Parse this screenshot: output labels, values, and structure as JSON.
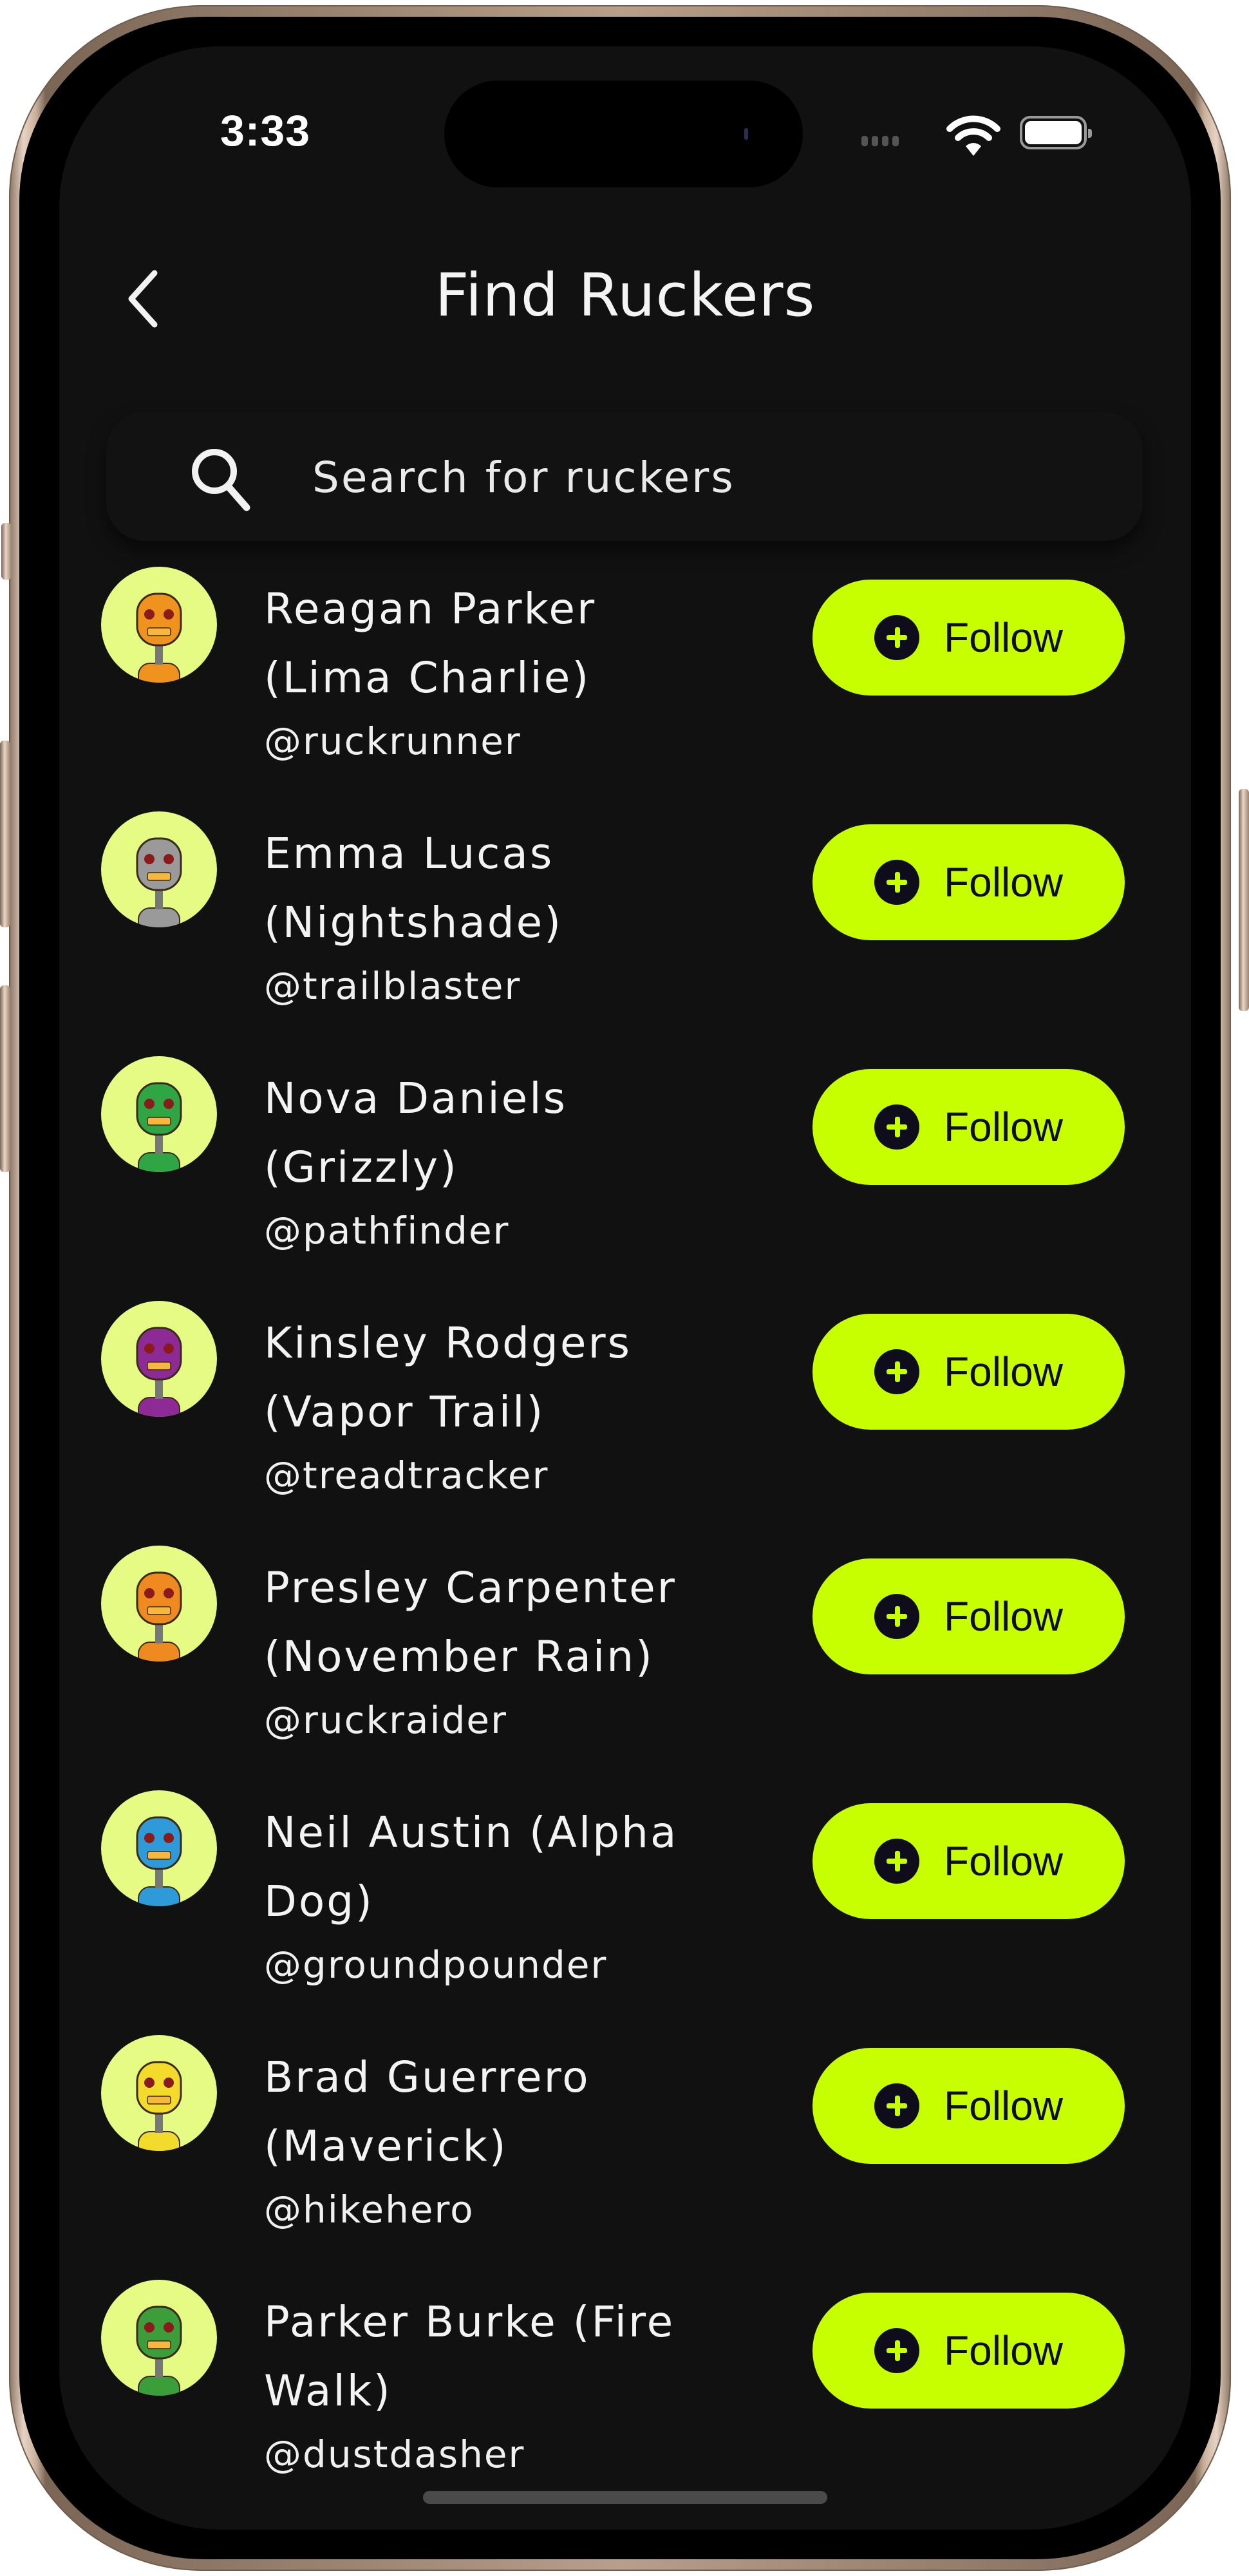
{
  "status_bar": {
    "time": "3:33",
    "signal_icon": "cellular-signal-icon",
    "wifi_icon": "wifi-icon",
    "battery_icon": "battery-icon"
  },
  "header": {
    "back_icon": "chevron-left-icon",
    "title": "Find Ruckers"
  },
  "search": {
    "icon": "search-icon",
    "placeholder": "Search for ruckers",
    "value": ""
  },
  "theme": {
    "background": "#111111",
    "accent": "#C8FF00",
    "avatar_background": "#E6FB84",
    "button_text": "#0F0D1C"
  },
  "users": [
    {
      "name": "Reagan Parker (Lima Charlie)",
      "handle": "@ruckrunner",
      "avatar": "orange-cyclops-robot",
      "avatar_color": "#F0921E",
      "follow_label": "Follow"
    },
    {
      "name": "Emma Lucas (Nightshade)",
      "handle": "@trailblaster",
      "avatar": "gray-mustache-robot",
      "avatar_color": "#9A9A9A",
      "follow_label": "Follow"
    },
    {
      "name": "Nova Daniels (Grizzly)",
      "handle": "@pathfinder",
      "avatar": "green-horned-robot",
      "avatar_color": "#2FA544",
      "follow_label": "Follow"
    },
    {
      "name": "Kinsley Rodgers (Vapor Trail)",
      "handle": "@treadtracker",
      "avatar": "purple-visor-robot",
      "avatar_color": "#8E2A96",
      "follow_label": "Follow"
    },
    {
      "name": "Presley Carpenter (November Rain)",
      "handle": "@ruckraider",
      "avatar": "orange-goggle-robot",
      "avatar_color": "#EE8A1F",
      "follow_label": "Follow"
    },
    {
      "name": "Neil Austin (Alpha Dog)",
      "handle": "@groundpounder",
      "avatar": "blue-horned-robot",
      "avatar_color": "#2E9AD8",
      "follow_label": "Follow"
    },
    {
      "name": "Brad Guerrero (Maverick)",
      "handle": "@hikehero",
      "avatar": "yellow-visor-robot",
      "avatar_color": "#F2DB2A",
      "follow_label": "Follow"
    },
    {
      "name": "Parker Burke (Fire Walk)",
      "handle": "@dustdasher",
      "avatar": "green-alien-robot",
      "avatar_color": "#3C9E3A",
      "follow_label": "Follow"
    }
  ]
}
